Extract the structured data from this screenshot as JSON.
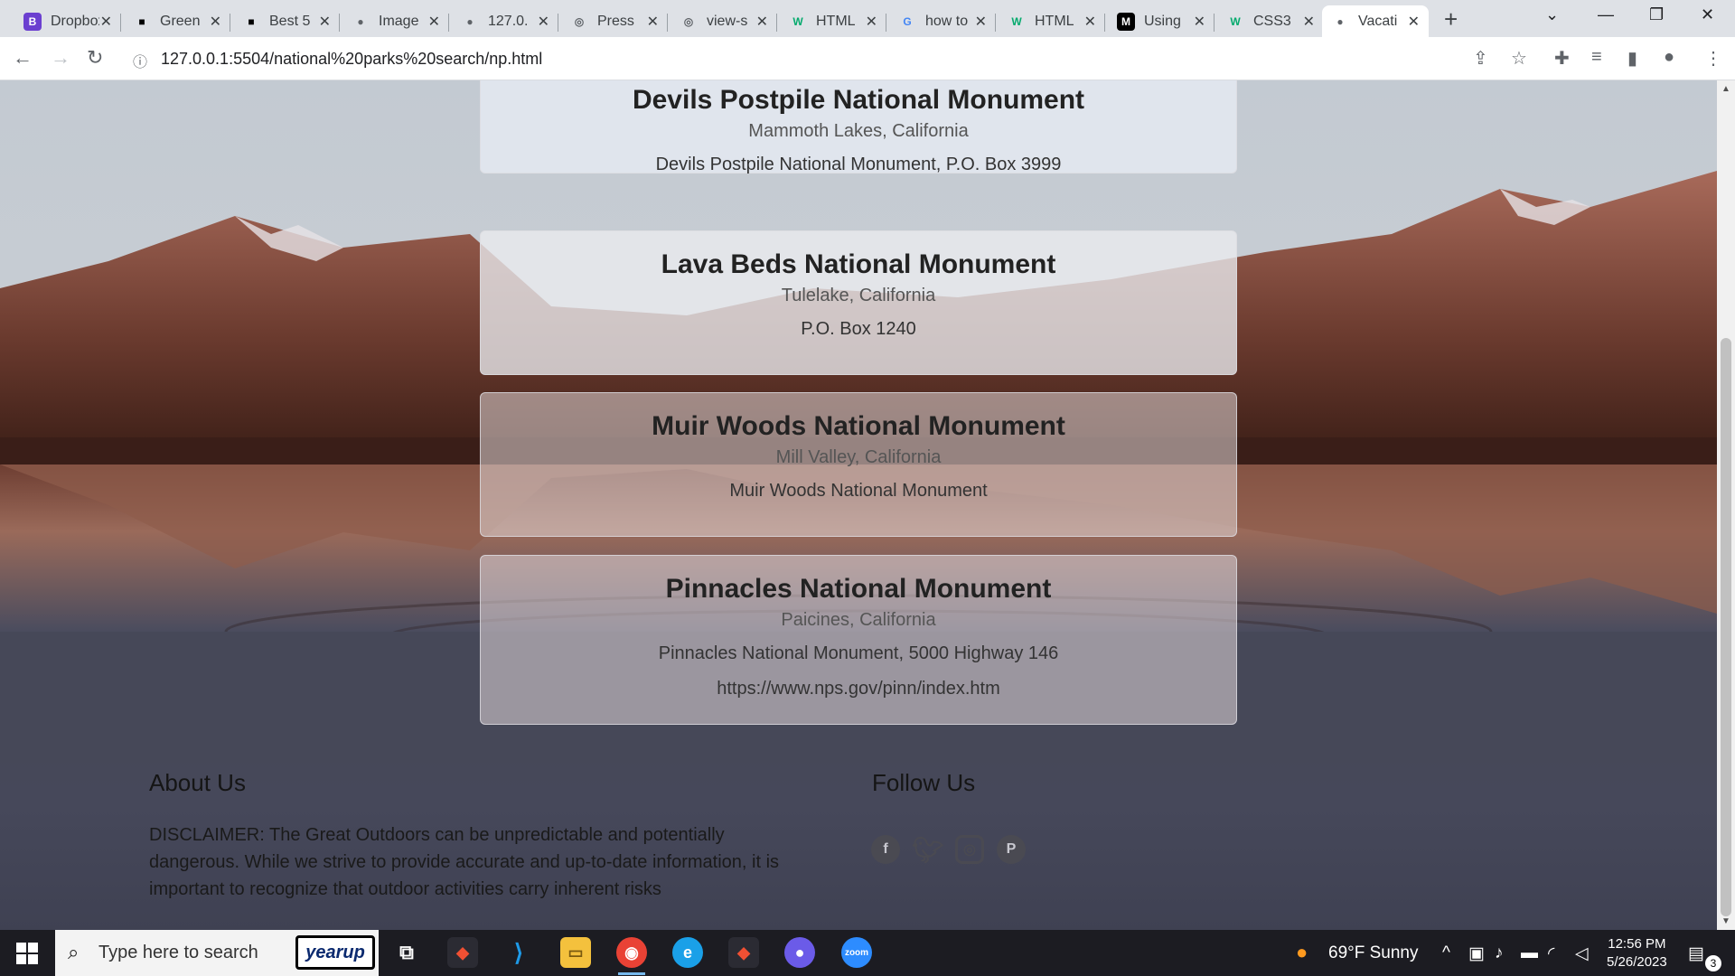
{
  "browser": {
    "tabs": [
      {
        "title": "Dropbox",
        "favicon": "B",
        "favicon_color": "#6b3fd0"
      },
      {
        "title": "Green",
        "favicon": "■",
        "favicon_color": "#000000"
      },
      {
        "title": "Best 5",
        "favicon": "■",
        "favicon_color": "#000000"
      },
      {
        "title": "Image",
        "favicon": "●",
        "favicon_color": "#5f6368"
      },
      {
        "title": "127.0.",
        "favicon": "●",
        "favicon_color": "#5f6368"
      },
      {
        "title": "Press",
        "favicon": "◎",
        "favicon_color": "#5f6368"
      },
      {
        "title": "view-s",
        "favicon": "◎",
        "favicon_color": "#5f6368"
      },
      {
        "title": "HTML",
        "favicon": "W",
        "favicon_color": "#04aa6d"
      },
      {
        "title": "how to",
        "favicon": "G",
        "favicon_color": "#4285f4"
      },
      {
        "title": "HTML",
        "favicon": "W",
        "favicon_color": "#04aa6d"
      },
      {
        "title": "Using",
        "favicon": "M",
        "favicon_color": "#000000"
      },
      {
        "title": "CSS3",
        "favicon": "W",
        "favicon_color": "#04aa6d"
      },
      {
        "title": "Vacati",
        "favicon": "●",
        "favicon_color": "#5f6368"
      }
    ],
    "address": "127.0.0.1:5504/national%20parks%20search/np.html"
  },
  "monuments": [
    {
      "name": "Devils Postpile National Monument",
      "location": "Mammoth Lakes, California",
      "address": "Devils Postpile National Monument, P.O. Box 3999"
    },
    {
      "name": "Lava Beds National Monument",
      "location": "Tulelake, California",
      "address": "P.O. Box 1240"
    },
    {
      "name": "Muir Woods National Monument",
      "location": "Mill Valley, California",
      "address": "Muir Woods National Monument"
    },
    {
      "name": "Pinnacles National Monument",
      "location": "Paicines, California",
      "address": "Pinnacles National Monument, 5000 Highway 146",
      "link": "https://www.nps.gov/pinn/index.htm"
    }
  ],
  "footer": {
    "about_title": "About Us",
    "about_text": "DISCLAIMER: The Great Outdoors can be unpredictable and potentially dangerous. While we strive to provide accurate and up-to-date information, it is important to recognize that outdoor activities carry inherent risks",
    "follow_title": "Follow Us",
    "social": [
      "facebook-icon",
      "twitter-icon",
      "instagram-icon",
      "pinterest-icon"
    ]
  },
  "taskbar": {
    "search_placeholder": "Type here to search",
    "pinned_logo": "yearup",
    "weather": "69°F  Sunny",
    "time": "12:56 PM",
    "date": "5/26/2023",
    "notifications": "3"
  }
}
